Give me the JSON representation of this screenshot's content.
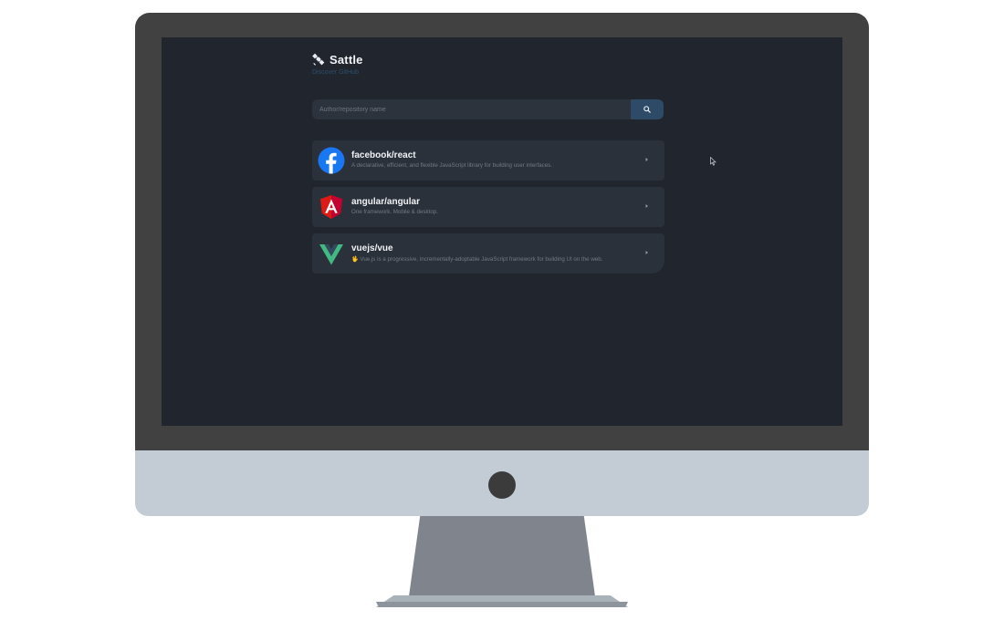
{
  "app": {
    "title": "Sattle",
    "tagline": "Discover GitHub",
    "logo_icon": "satellite-icon"
  },
  "search": {
    "placeholder": "Author/repository name",
    "value": "",
    "button_icon": "search-icon"
  },
  "repositories": [
    {
      "name": "facebook/react",
      "description": "A declarative, efficient, and flexible JavaScript library for building user interfaces.",
      "icon": "facebook-logo-icon",
      "color": "#1877f2"
    },
    {
      "name": "angular/angular",
      "description": "One framework. Mobile & desktop.",
      "icon": "angular-logo-icon",
      "color": "#dd1b16"
    },
    {
      "name": "vuejs/vue",
      "description": "🖖 Vue.js is a progressive, incrementally-adoptable JavaScript framework for building UI on the web.",
      "icon": "vue-logo-icon",
      "color": "#42b883"
    }
  ],
  "colors": {
    "screen_background": "#20252e",
    "card_background": "#2b313a",
    "search_button": "#2d4a66",
    "tagline": "#2c4f6b"
  }
}
